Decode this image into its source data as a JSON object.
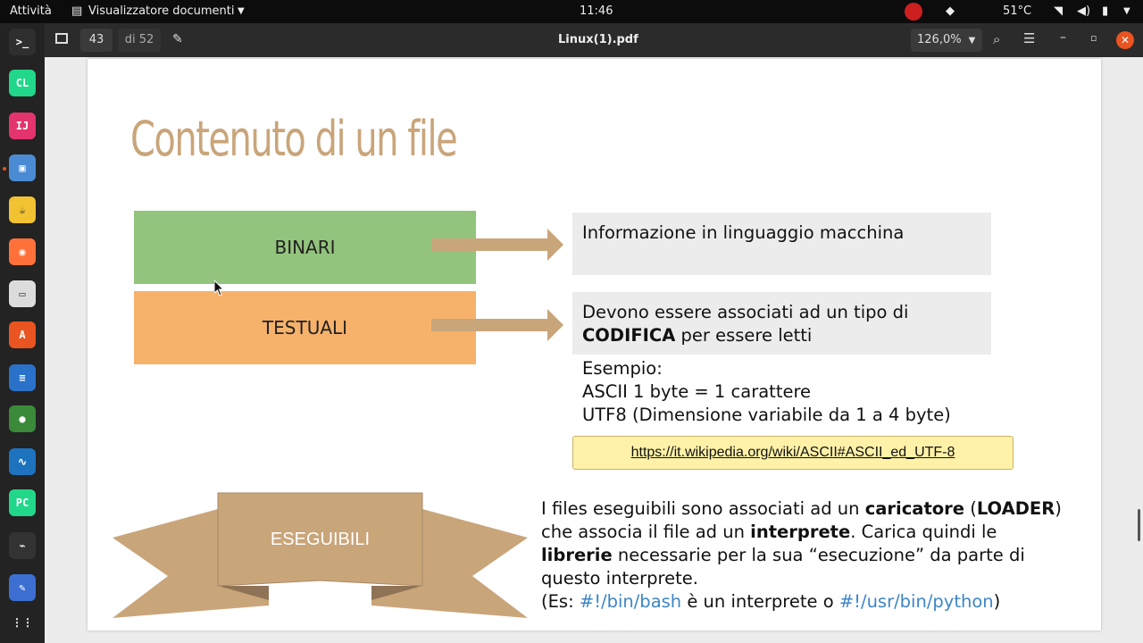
{
  "topbar": {
    "activities": "Attività",
    "app_menu": "Visualizzatore documenti",
    "clock": "11:46",
    "temperature": "51°C"
  },
  "header": {
    "page_current": "43",
    "page_total": "di 52",
    "title": "Linux(1).pdf",
    "zoom": "126,0%"
  },
  "dock": [
    {
      "name": "terminal-icon",
      "color": "#2f2f2f",
      "glyph": ">_"
    },
    {
      "name": "clion-icon",
      "color": "#21d789",
      "glyph": "CL"
    },
    {
      "name": "intellij-icon",
      "color": "#e3346d",
      "glyph": "IJ"
    },
    {
      "name": "remote-desktop-icon",
      "color": "#4b8bd4",
      "glyph": "▣"
    },
    {
      "name": "teapot-icon",
      "color": "#f1c232",
      "glyph": "☕"
    },
    {
      "name": "firefox-icon",
      "color": "#ff7139",
      "glyph": "◉"
    },
    {
      "name": "files-icon",
      "color": "#dcdcdc",
      "glyph": "▭"
    },
    {
      "name": "software-center-icon",
      "color": "#e95420",
      "glyph": "A"
    },
    {
      "name": "writer-icon",
      "color": "#2a72c9",
      "glyph": "≡"
    },
    {
      "name": "media-icon",
      "color": "#3a8a3a",
      "glyph": "●"
    },
    {
      "name": "system-monitor-icon",
      "color": "#1e73be",
      "glyph": "∿"
    },
    {
      "name": "pycharm-icon",
      "color": "#21d789",
      "glyph": "PC"
    },
    {
      "name": "activity-icon",
      "color": "#333333",
      "glyph": "⌁"
    },
    {
      "name": "text-editor-icon",
      "color": "#3c6fd1",
      "glyph": "✎"
    },
    {
      "name": "show-apps-icon",
      "color": "#232323",
      "glyph": "⋮⋮"
    }
  ],
  "slide": {
    "title": "Contenuto di un file",
    "binari_label": "BINARI",
    "testuali_label": "TESTUALI",
    "binari_desc": "Informazione in linguaggio macchina",
    "testuali_desc_1": "Devono essere associati ad un tipo di",
    "testuali_desc_bold": "CODIFICA",
    "testuali_desc_2": " per essere letti",
    "example_1": "Esempio:",
    "example_2": "ASCII 1 byte = 1 carattere",
    "example_3": "UTF8 (Dimensione variabile da 1 a 4 byte)",
    "link": "https://it.wikipedia.org/wiki/ASCII#ASCII_ed_UTF-8",
    "eseguibili_label": "ESEGUIBILI",
    "exe_line1_a": "I files eseguibili sono associati ad un ",
    "exe_line1_b": "caricatore",
    "exe_line1_c": " (",
    "exe_line1_d": "LOADER",
    "exe_line1_e": ")",
    "exe_line2_a": "che associa il file ad un ",
    "exe_line2_b": "interprete",
    "exe_line2_c": ". Carica quindi le",
    "exe_line3_a": "librerie",
    "exe_line3_b": " necessarie per la sua “esecuzione” da parte di",
    "exe_line4": "questo interprete.",
    "exe_line5_a": " (Es: ",
    "exe_line5_b": "#!/bin/bash",
    "exe_line5_c": " è un interprete  o ",
    "exe_line5_d": "#!/usr/bin/python",
    "exe_line5_e": ")"
  },
  "colors": {
    "binari": "#93c47d",
    "testuali": "#f6b26b",
    "tan": "#c9a57a",
    "title": "#c9a57a",
    "link_box": "#fff2a8"
  }
}
